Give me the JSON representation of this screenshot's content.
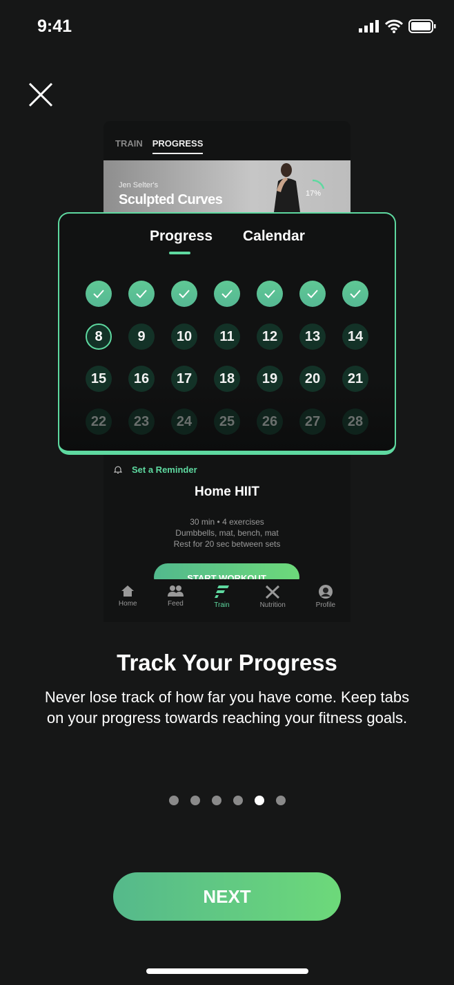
{
  "status_bar": {
    "time": "9:41"
  },
  "mockup": {
    "tabs": [
      "TRAIN",
      "PROGRESS"
    ],
    "active_tab": "PROGRESS",
    "banner": {
      "subtitle": "Jen Selter's",
      "title": "Sculpted Curves",
      "progress": "17%",
      "progress_value": 0.17
    },
    "reminder": "Set a Reminder",
    "workout_title": "Home HIIT",
    "details": [
      "30 min • 4 exercises",
      "Dumbbells, mat, bench, mat",
      "Rest for 20 sec between sets"
    ],
    "start_button": "START WORKOUT",
    "nav": [
      {
        "label": "Home",
        "icon": "home-icon"
      },
      {
        "label": "Feed",
        "icon": "people-icon"
      },
      {
        "label": "Train",
        "icon": "train-logo-icon",
        "active": true
      },
      {
        "label": "Nutrition",
        "icon": "fork-knife-icon"
      },
      {
        "label": "Profile",
        "icon": "profile-icon"
      }
    ]
  },
  "calendar_card": {
    "tabs": [
      "Progress",
      "Calendar"
    ],
    "active_tab": "Progress",
    "completed_days": 7,
    "today": "8",
    "days": [
      "8",
      "9",
      "10",
      "11",
      "12",
      "13",
      "14",
      "15",
      "16",
      "17",
      "18",
      "19",
      "20",
      "21",
      "22",
      "23",
      "24",
      "25",
      "26",
      "27",
      "28"
    ]
  },
  "onboarding": {
    "title": "Track Your Progress",
    "body": "Never lose track of how far you have come. Keep tabs on your progress towards reaching your fitness goals.",
    "page_count": 6,
    "current_page": 5,
    "next_button": "NEXT"
  },
  "colors": {
    "accent": "#5ed9a0",
    "background": "#161717"
  }
}
